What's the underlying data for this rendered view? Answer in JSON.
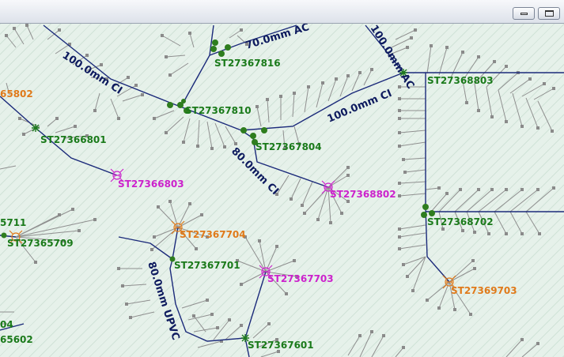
{
  "colors": {
    "main": "#1b2a7a",
    "service": "#8f8f8f",
    "node": "#1e7a1e",
    "valve": "#2e7d1e",
    "hydrant_magenta": "#cc22cc",
    "hydrant_orange": "#e07a1a",
    "label_green": "#1a7a1a",
    "label_magenta": "#cc22cc",
    "label_orange": "#e07a1a",
    "pipe_label": "#0d1a5e"
  },
  "pipe_labels": [
    {
      "id": "p1",
      "text": "100.0mm CI"
    },
    {
      "id": "p2",
      "text": "70.0mm AC"
    },
    {
      "id": "p3",
      "text": "100.0mm AC"
    },
    {
      "id": "p4",
      "text": "100.0mm CI"
    },
    {
      "id": "p5",
      "text": "80.0mm CI"
    },
    {
      "id": "p6",
      "text": "80.0mm UPVC"
    }
  ],
  "node_labels": [
    {
      "id": "n1",
      "text": "ST27367816",
      "kind": "junction"
    },
    {
      "id": "n2",
      "text": "ST27367810",
      "kind": "junction"
    },
    {
      "id": "n3",
      "text": "ST27367804",
      "kind": "junction"
    },
    {
      "id": "n4",
      "text": "ST27366801",
      "kind": "junction"
    },
    {
      "id": "n5",
      "text": "ST27368803",
      "kind": "junction"
    },
    {
      "id": "n6",
      "text": "ST27366803",
      "kind": "hydrant-magenta"
    },
    {
      "id": "n7",
      "text": "ST27368802",
      "kind": "hydrant-magenta"
    },
    {
      "id": "n8",
      "text": "ST27367704",
      "kind": "hydrant-orange"
    },
    {
      "id": "n9",
      "text": "ST27368702",
      "kind": "junction"
    },
    {
      "id": "n10",
      "text": "ST27365709",
      "kind": "junction"
    },
    {
      "id": "n11",
      "text": "5711",
      "kind": "junction-orange"
    },
    {
      "id": "n12",
      "text": "ST27367701",
      "kind": "junction"
    },
    {
      "id": "n13",
      "text": "ST27367703",
      "kind": "hydrant-magenta"
    },
    {
      "id": "n14",
      "text": "ST27369703",
      "kind": "hydrant-orange"
    },
    {
      "id": "n15",
      "text": "ST27367601",
      "kind": "junction"
    },
    {
      "id": "n16",
      "text": "65602",
      "kind": "junction"
    },
    {
      "id": "n17",
      "text": "04",
      "kind": "junction"
    },
    {
      "id": "n18",
      "text": "65802",
      "kind": "orange"
    }
  ]
}
